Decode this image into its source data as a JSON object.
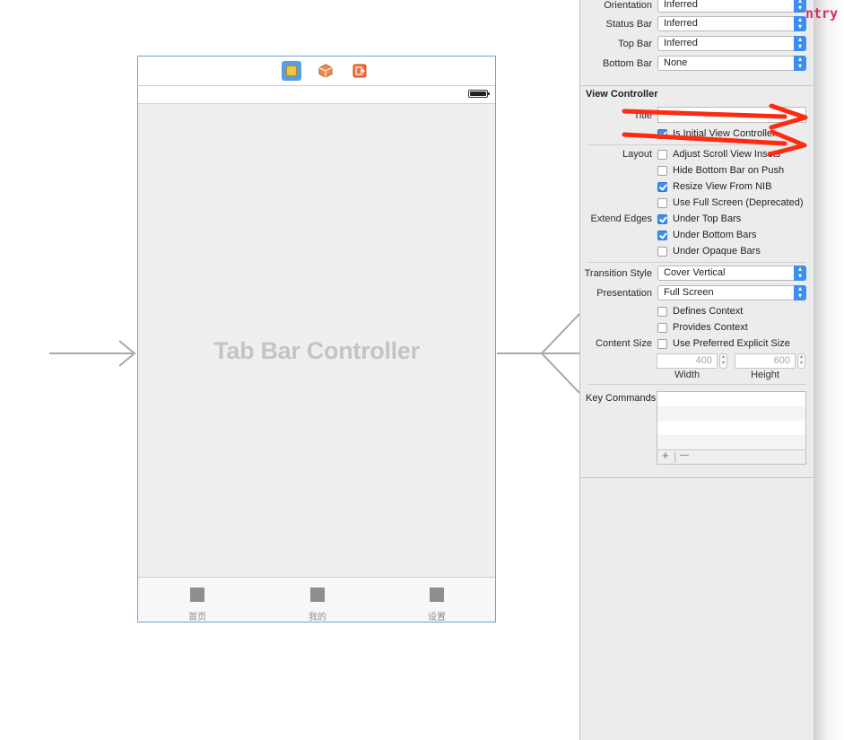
{
  "scene": {
    "title": "Tab Bar Controller",
    "dock_icons": [
      "view-controller-icon",
      "first-responder-cube-icon",
      "exit-icon"
    ],
    "tabs": [
      {
        "label": "首页"
      },
      {
        "label": "我的"
      },
      {
        "label": "设置"
      }
    ]
  },
  "code_peek": "ntry",
  "inspector": {
    "simulated_metrics": [
      {
        "label": "Orientation",
        "value": "Inferred"
      },
      {
        "label": "Status Bar",
        "value": "Inferred"
      },
      {
        "label": "Top Bar",
        "value": "Inferred"
      },
      {
        "label": "Bottom Bar",
        "value": "None"
      }
    ],
    "view_controller": {
      "section_title": "View Controller",
      "title_label": "Title",
      "title_value": "",
      "is_initial": {
        "label": "Is Initial View Controller",
        "checked": true
      },
      "layout_label": "Layout",
      "layout_options": [
        {
          "label": "Adjust Scroll View Insets",
          "checked": false
        },
        {
          "label": "Hide Bottom Bar on Push",
          "checked": false
        },
        {
          "label": "Resize View From NIB",
          "checked": true
        },
        {
          "label": "Use Full Screen (Deprecated)",
          "checked": false
        }
      ],
      "extend_edges_label": "Extend Edges",
      "extend_edges_options": [
        {
          "label": "Under Top Bars",
          "checked": true
        },
        {
          "label": "Under Bottom Bars",
          "checked": true
        },
        {
          "label": "Under Opaque Bars",
          "checked": false
        }
      ],
      "transition_style": {
        "label": "Transition Style",
        "value": "Cover Vertical"
      },
      "presentation": {
        "label": "Presentation",
        "value": "Full Screen"
      },
      "context_options": [
        {
          "label": "Defines Context",
          "checked": false
        },
        {
          "label": "Provides Context",
          "checked": false
        }
      ],
      "content_size": {
        "label": "Content Size",
        "checkbox_label": "Use Preferred Explicit Size",
        "checked": false,
        "width": "400",
        "height": "600",
        "width_label": "Width",
        "height_label": "Height"
      },
      "key_commands_label": "Key Commands",
      "add_symbol": "+",
      "remove_symbol": "—"
    }
  },
  "colors": {
    "selection_blue": "#3b8ef0",
    "scene_border": "#6e9fd8",
    "annotation_red": "#ff2a12"
  }
}
